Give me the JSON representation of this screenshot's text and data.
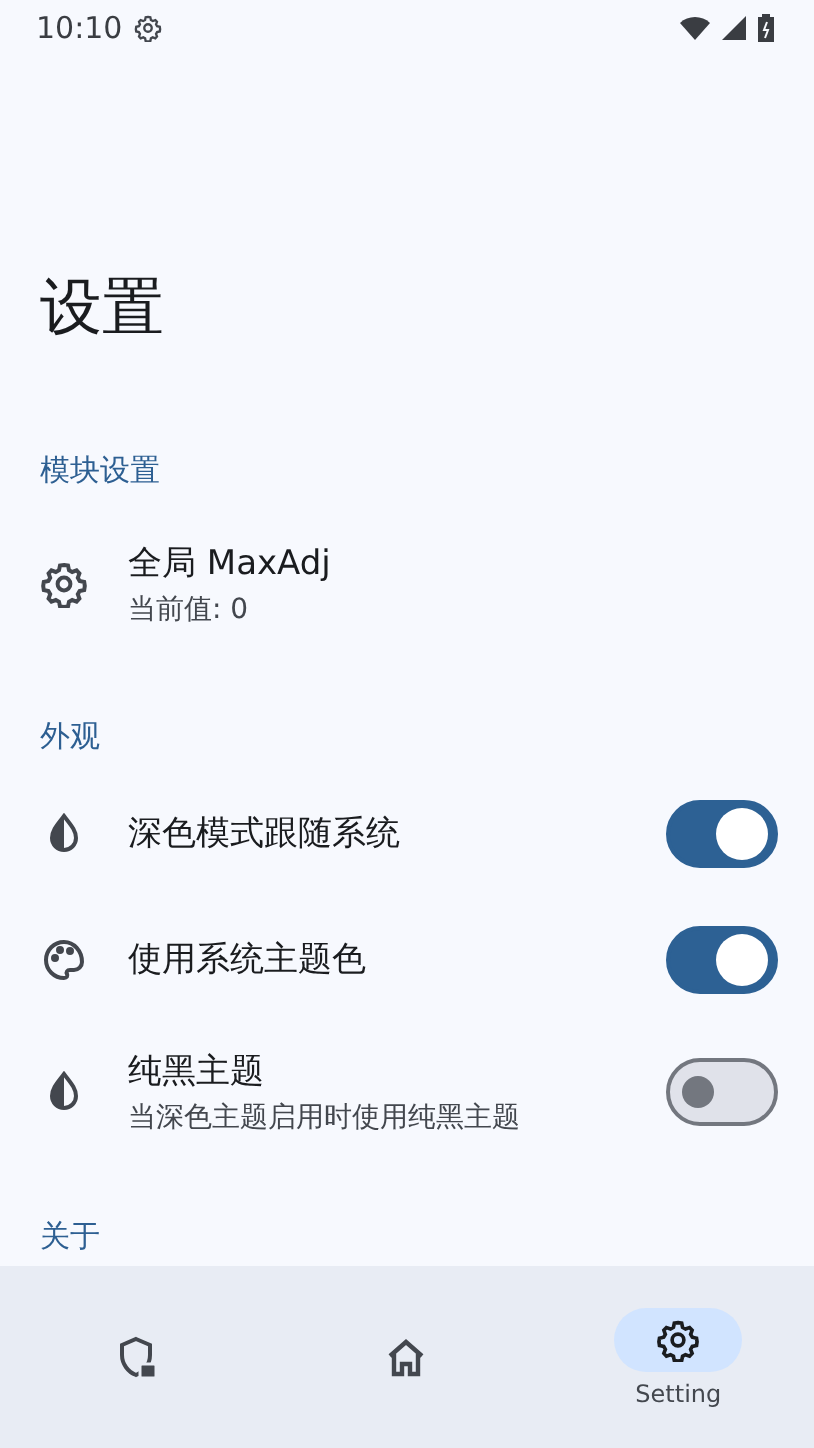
{
  "status_bar": {
    "time": "10:10"
  },
  "title": "设置",
  "sections": [
    {
      "header": "模块设置",
      "items": [
        {
          "kind": "value",
          "title": "全局 MaxAdj",
          "subtitle": "当前值: 0"
        }
      ]
    },
    {
      "header": "外观",
      "items": [
        {
          "kind": "switch",
          "title": "深色模式跟随系统",
          "on": true
        },
        {
          "kind": "switch",
          "title": "使用系统主题色",
          "on": true
        },
        {
          "kind": "switch",
          "title": "纯黑主题",
          "subtitle": "当深色主题启用时使用纯黑主题",
          "on": false
        }
      ]
    },
    {
      "header": "关于"
    }
  ],
  "nav": [
    {
      "selected": false
    },
    {
      "selected": false
    },
    {
      "label": "Setting",
      "selected": true
    }
  ]
}
